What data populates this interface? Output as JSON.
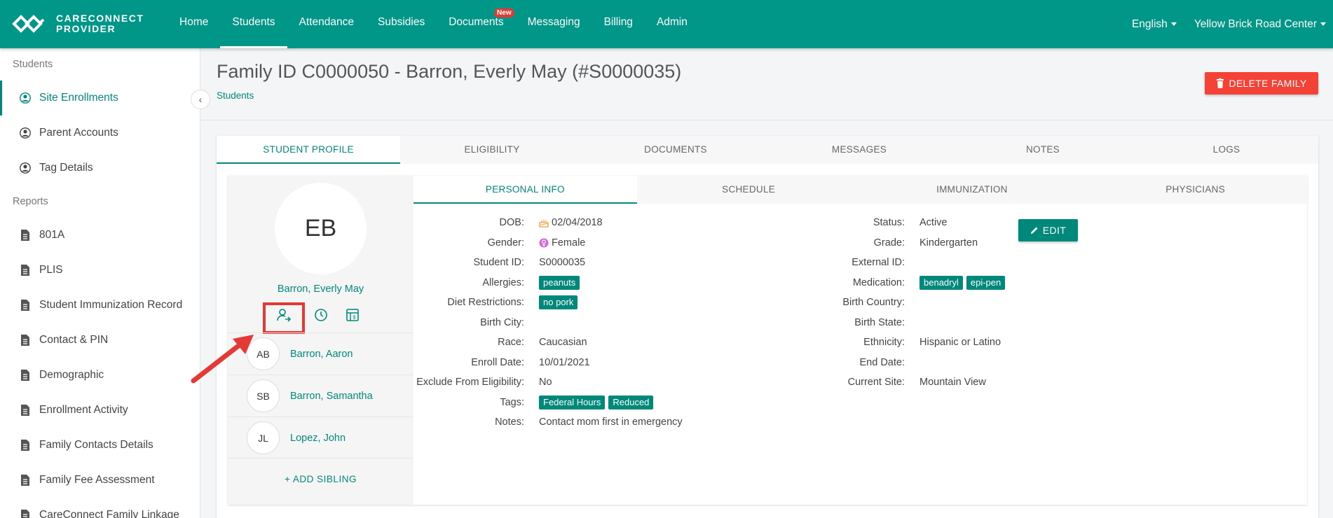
{
  "app": {
    "logo_line1": "CARECONNECT",
    "logo_line2": "PROVIDER"
  },
  "nav": {
    "items": [
      {
        "label": "Home"
      },
      {
        "label": "Students"
      },
      {
        "label": "Attendance"
      },
      {
        "label": "Subsidies"
      },
      {
        "label": "Documents"
      },
      {
        "label": "Messaging"
      },
      {
        "label": "Billing"
      },
      {
        "label": "Admin"
      }
    ],
    "active": "Students",
    "new_badge": "New",
    "language": "English",
    "center": "Yellow Brick Road Center"
  },
  "sidebar": {
    "section_students": "Students",
    "student_items": [
      {
        "label": "Site Enrollments",
        "icon": "user-circle-icon"
      },
      {
        "label": "Parent Accounts",
        "icon": "user-circle-icon"
      },
      {
        "label": "Tag Details",
        "icon": "user-circle-icon"
      }
    ],
    "section_reports": "Reports",
    "report_items": [
      {
        "label": "801A",
        "icon": "document-icon"
      },
      {
        "label": "PLIS",
        "icon": "document-icon"
      },
      {
        "label": "Student Immunization Record",
        "icon": "document-icon"
      },
      {
        "label": "Contact & PIN",
        "icon": "document-icon"
      },
      {
        "label": "Demographic",
        "icon": "document-icon"
      },
      {
        "label": "Enrollment Activity",
        "icon": "document-icon"
      },
      {
        "label": "Family Contacts Details",
        "icon": "document-icon"
      },
      {
        "label": "Family Fee Assessment",
        "icon": "document-icon"
      },
      {
        "label": "CareConnect Family Linkage",
        "icon": "document-icon"
      }
    ],
    "collapse_glyph": "‹"
  },
  "header": {
    "title": "Family ID C0000050 - Barron, Everly May (#S0000035)",
    "breadcrumb": "Students",
    "delete_label": "DELETE FAMILY"
  },
  "tabs": [
    {
      "label": "STUDENT PROFILE"
    },
    {
      "label": "ELIGIBILITY"
    },
    {
      "label": "DOCUMENTS"
    },
    {
      "label": "MESSAGES"
    },
    {
      "label": "NOTES"
    },
    {
      "label": "LOGS"
    }
  ],
  "student": {
    "initials": "EB",
    "name": "Barron, Everly May",
    "siblings": [
      {
        "initials": "AB",
        "name": "Barron, Aaron"
      },
      {
        "initials": "SB",
        "name": "Barron, Samantha"
      },
      {
        "initials": "JL",
        "name": "Lopez, John"
      }
    ],
    "add_sibling_label": "+   ADD SIBLING"
  },
  "subtabs": [
    {
      "label": "PERSONAL INFO"
    },
    {
      "label": "SCHEDULE"
    },
    {
      "label": "IMMUNIZATION"
    },
    {
      "label": "PHYSICIANS"
    }
  ],
  "personal_info": {
    "left": [
      {
        "label": "DOB:",
        "value": "02/04/2018"
      },
      {
        "label": "Gender:",
        "value": "Female"
      },
      {
        "label": "Student ID:",
        "value": "S0000035"
      },
      {
        "label": "Allergies:",
        "chips": [
          "peanuts"
        ]
      },
      {
        "label": "Diet Restrictions:",
        "chips": [
          "no pork"
        ]
      },
      {
        "label": "Birth City:",
        "value": ""
      },
      {
        "label": "Race:",
        "value": "Caucasian"
      },
      {
        "label": "Enroll Date:",
        "value": "10/01/2021"
      },
      {
        "label": "Exclude From Eligibility:",
        "value": "No"
      },
      {
        "label": "Tags:",
        "chips": [
          "Federal Hours",
          "Reduced"
        ]
      },
      {
        "label": "Notes:",
        "value": "Contact mom first in emergency"
      }
    ],
    "right": [
      {
        "label": "Status:",
        "value": "Active"
      },
      {
        "label": "Grade:",
        "value": "Kindergarten"
      },
      {
        "label": "External ID:",
        "value": ""
      },
      {
        "label": "Medication:",
        "chips": [
          "benadryl",
          "epi-pen"
        ]
      },
      {
        "label": "Birth Country:",
        "value": ""
      },
      {
        "label": "Birth State:",
        "value": ""
      },
      {
        "label": "Ethnicity:",
        "value": "Hispanic or Latino"
      },
      {
        "label": "End Date:",
        "value": ""
      },
      {
        "label": "Current Site:",
        "value": "Mountain View"
      }
    ],
    "edit_label": "EDIT"
  },
  "colors": {
    "primary": "#009688",
    "accent_text": "#00897b",
    "danger": "#f44336",
    "highlight": "#e53935"
  }
}
